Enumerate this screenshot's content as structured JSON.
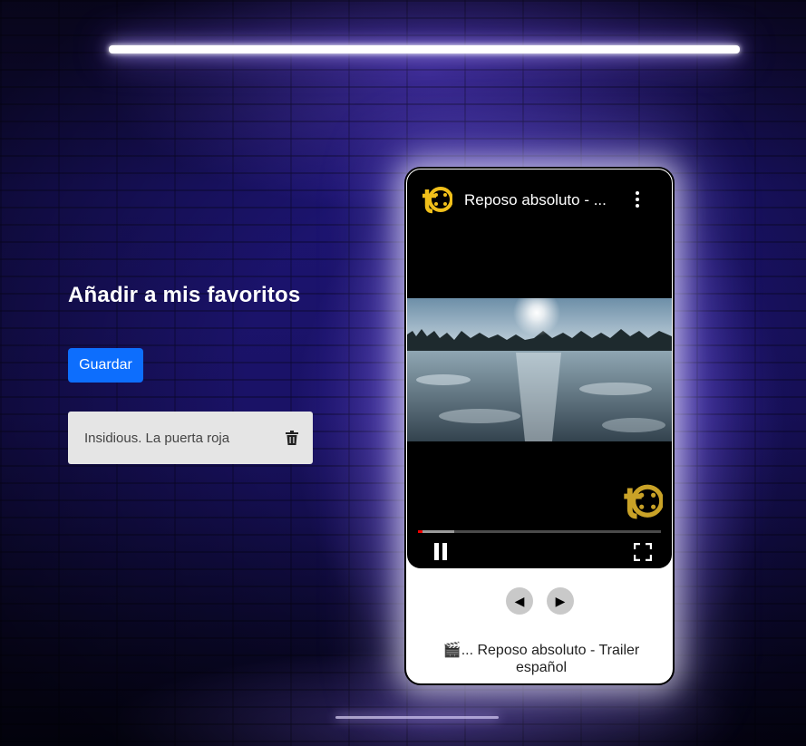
{
  "favorites": {
    "heading": "Añadir a mis favoritos",
    "save_label": "Guardar",
    "items": [
      {
        "title": "Insidious. La puerta roja",
        "icon": "trash-icon"
      }
    ]
  },
  "player": {
    "channel_icon": "channel-logo-icon",
    "video_title": "Reposo absoluto - ...",
    "menu_icon": "more-vert-icon",
    "pause_icon": "pause-icon",
    "fullscreen_icon": "fullscreen-icon",
    "progress": {
      "played": 0.02,
      "loaded": 0.15
    }
  },
  "navigation": {
    "prev_label": "◀",
    "next_label": "▶"
  },
  "caption": "🎬... Reposo absoluto - Trailer español",
  "colors": {
    "accent": "#0d6efd",
    "logo_gold": "#f0bf1a",
    "neon": "#7b5cff"
  }
}
